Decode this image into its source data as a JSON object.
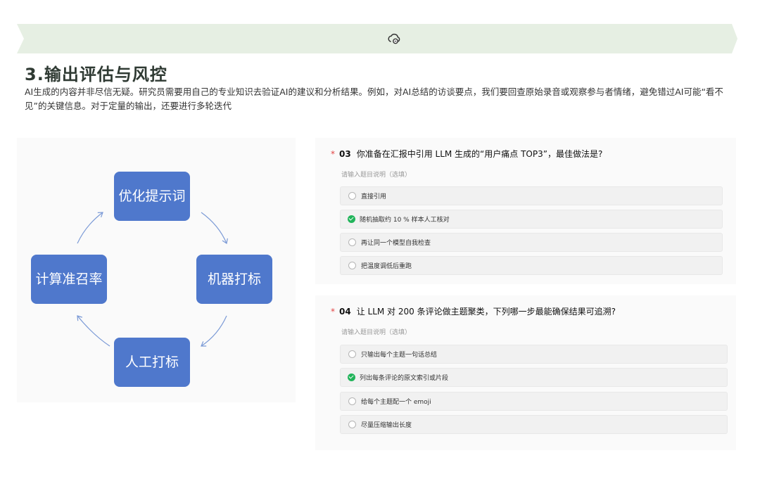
{
  "header": {
    "icon": "cloud-sync-icon",
    "title": "3.输出评估与风控",
    "description": "AI生成的内容并非尽信无疑。研究员需要用自己的专业知识去验证AI的建议和分析结果。例如，对AI总结的访谈要点，我们要回查原始录音或观察参与者情绪，避免错过AI可能“看不见”的关键信息。对于定量的输出，还要进行多轮迭代"
  },
  "diagram": {
    "nodes": {
      "top": "优化提示词",
      "right": "机器打标",
      "bottom": "人工打标",
      "left": "计算准召率"
    },
    "node_color": "#4f78cc",
    "arrow_color": "#7b9ad6"
  },
  "questions": [
    {
      "required": "*",
      "number": "03",
      "text": "你准备在汇报中引用 LLM 生成的“用户痛点 TOP3”，最佳做法是?",
      "hint": "请输入题目说明（选填）",
      "options": [
        {
          "label": "直接引用",
          "checked": false
        },
        {
          "label": "随机抽取约 10 % 样本人工核对",
          "checked": true
        },
        {
          "label": "再让同一个模型自我检查",
          "checked": false
        },
        {
          "label": "把温度调低后重跑",
          "checked": false
        }
      ]
    },
    {
      "required": "*",
      "number": "04",
      "text": "让 LLM 对 200 条评论做主题聚类，下列哪一步最能确保结果可追溯?",
      "hint": "请输入题目说明（选填）",
      "options": [
        {
          "label": "只输出每个主题一句话总结",
          "checked": false
        },
        {
          "label": "列出每条评论的原文索引或片段",
          "checked": true
        },
        {
          "label": "给每个主题配一个 emoji",
          "checked": false
        },
        {
          "label": "尽量压缩输出长度",
          "checked": false
        }
      ]
    }
  ],
  "colors": {
    "banner": "#e6efe3",
    "check": "#21b45a",
    "required": "#e24444"
  }
}
